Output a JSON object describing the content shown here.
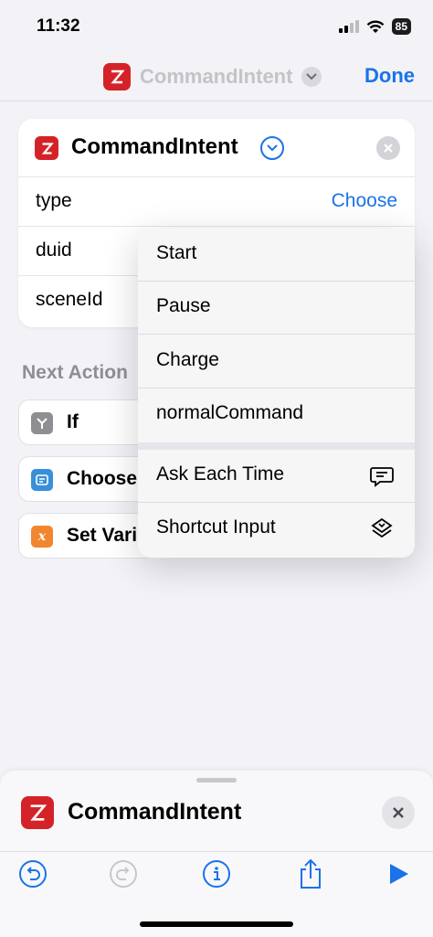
{
  "status_bar": {
    "time": "11:32",
    "battery": "85"
  },
  "nav": {
    "title": "CommandIntent",
    "done_label": "Done"
  },
  "card": {
    "title": "CommandIntent",
    "params": [
      {
        "label": "type",
        "value": "Choose"
      },
      {
        "label": "duid"
      },
      {
        "label": "sceneId"
      }
    ]
  },
  "next_actions": {
    "heading": "Next Action",
    "items": [
      {
        "label": "If",
        "icon": "if-icon",
        "color": "#8e8e93"
      },
      {
        "label": "Choose",
        "icon": "choose-menu-icon",
        "color": "#3a8fd9"
      },
      {
        "label": "Set Vari",
        "icon": "variable-icon",
        "color": "#f2862e"
      }
    ]
  },
  "menu": {
    "options": [
      "Start",
      "Pause",
      "Charge",
      "normalCommand"
    ],
    "extras": [
      {
        "label": "Ask Each Time",
        "icon": "message-bubble-icon"
      },
      {
        "label": "Shortcut Input",
        "icon": "shortcut-layers-icon"
      }
    ]
  },
  "sheet": {
    "title": "CommandIntent"
  },
  "toolbar": {
    "items": [
      "undo-icon",
      "redo-icon",
      "info-icon",
      "share-icon",
      "play-icon"
    ]
  },
  "colors": {
    "accent": "#1a73e8",
    "brand": "#d42328"
  }
}
